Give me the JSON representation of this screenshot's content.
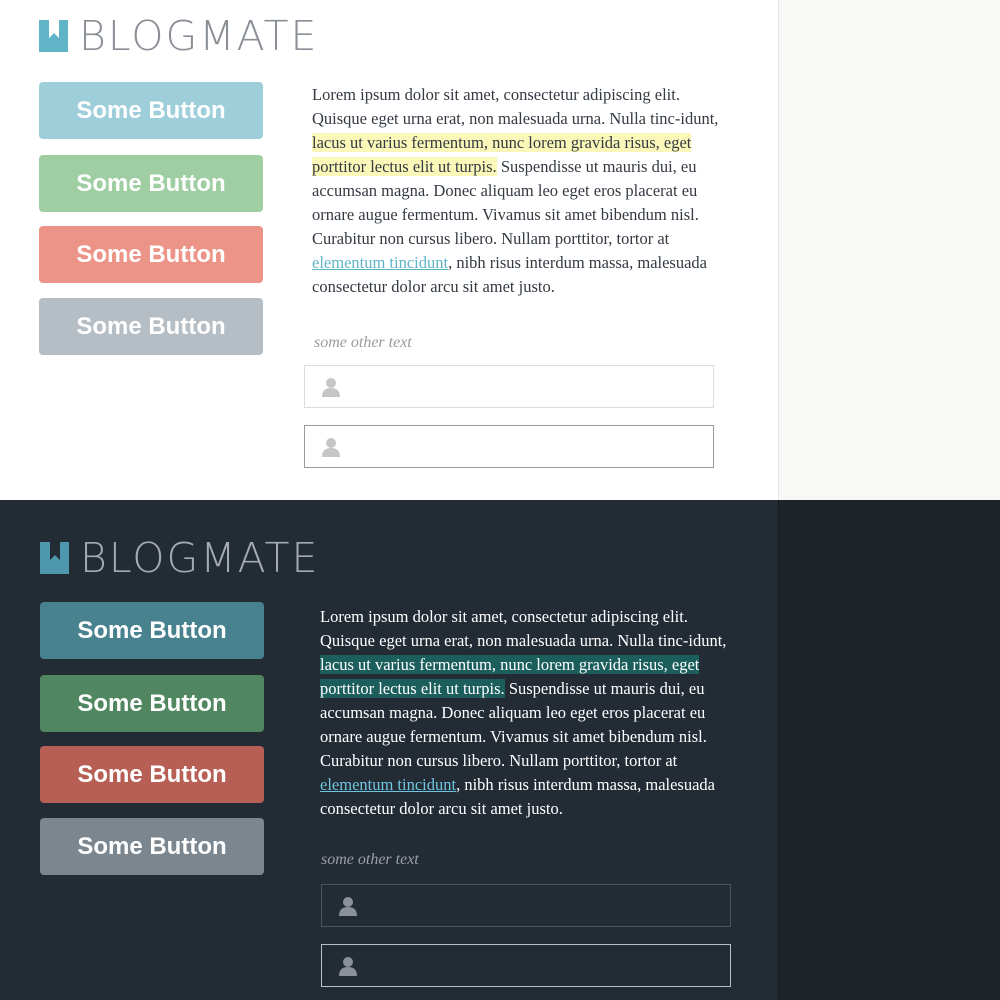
{
  "colors": {
    "logo_light": "#5fb4c8",
    "logo_dark": "#4e98ae",
    "light_buttons": [
      "#9dced9",
      "#9ecea2",
      "#ec9488",
      "#b6bec5"
    ],
    "dark_buttons": [
      "#49828f",
      "#508660",
      "#b75f55",
      "#7c868f"
    ]
  },
  "light": {
    "logo": {
      "icon": "bookmark-logo-icon",
      "text": "BLOGMATE"
    },
    "buttons": [
      "Some Button",
      "Some Button",
      "Some Button",
      "Some Button"
    ],
    "paragraph": {
      "before": "Lorem ipsum dolor sit amet, consectetur adipiscing elit. Quisque eget urna erat, non malesuada urna. Nulla tinc-idunt,",
      "highlight": " lacus ut varius fermentum, nunc lorem gravida risus, eget porttitor lectus elit ut turpis.",
      "middle": " Suspendisse ut mauris dui, eu accumsan magna. Donec aliquam leo eget eros placerat eu ornare augue fermentum. Vivamus sit amet bibendum nisl. Curabitur non cursus libero. Nullam porttitor, tortor at ",
      "link": "elementum tincidunt",
      "after": ", nibh risus interdum massa, malesuada consectetur dolor arcu sit amet justo."
    },
    "other_text": "some other text",
    "inputs": [
      {
        "icon": "user-icon",
        "value": "",
        "placeholder": ""
      },
      {
        "icon": "user-icon",
        "value": "",
        "placeholder": ""
      }
    ]
  },
  "dark": {
    "logo": {
      "icon": "bookmark-logo-icon",
      "text": "BLOGMATE"
    },
    "buttons": [
      "Some Button",
      "Some Button",
      "Some Button",
      "Some Button"
    ],
    "paragraph": {
      "before": "Lorem ipsum dolor sit amet, consectetur adipiscing elit. Quisque eget urna erat, non malesuada urna. Nulla tinc-idunt,",
      "highlight": " lacus ut varius fermentum, nunc lorem gravida risus, eget porttitor lectus elit ut turpis.",
      "middle": " Suspendisse ut mauris dui, eu accumsan magna. Donec aliquam leo eget eros placerat eu ornare augue fermentum. Vivamus sit amet bibendum nisl. Curabitur non cursus libero. Nullam porttitor, tortor at ",
      "link": "elementum tincidunt",
      "after": ", nibh risus interdum massa, malesuada consectetur dolor arcu sit amet justo."
    },
    "other_text": "some other text",
    "inputs": [
      {
        "icon": "user-icon",
        "value": "",
        "placeholder": ""
      },
      {
        "icon": "user-icon",
        "value": "",
        "placeholder": ""
      }
    ]
  }
}
